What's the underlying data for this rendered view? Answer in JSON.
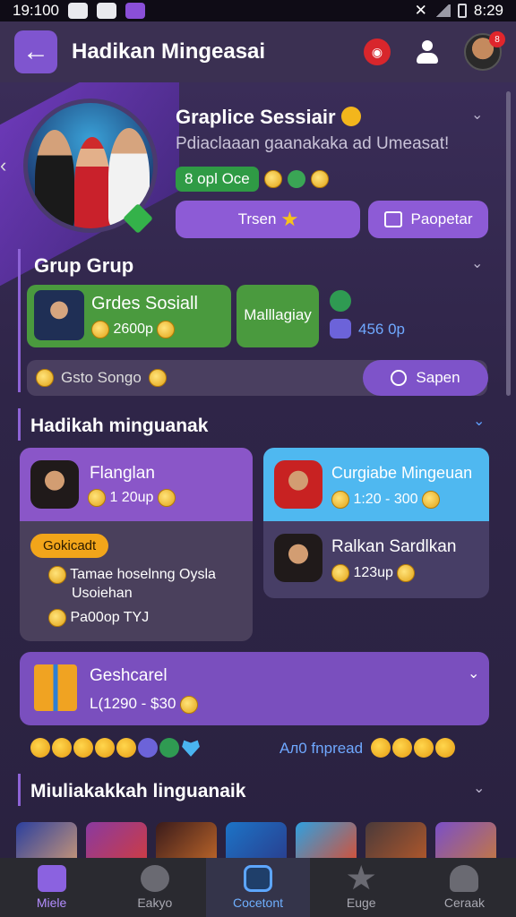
{
  "status_bar": {
    "time": "19:100",
    "time_right": "8:29"
  },
  "header": {
    "title": "Hadikan Mingeasai",
    "notification_badge": "8"
  },
  "profile": {
    "name": "Graplice Sessiair",
    "subtitle": "Pdiaclaaan gaanakaka ad Umeasat!",
    "level_label": "8 opl Oce",
    "buttons": {
      "primary": "Trsen",
      "secondary": "Paopetar"
    }
  },
  "group_section": {
    "title": "Grup Grup",
    "card_main": {
      "title": "Grdes Sosiall",
      "value": "2600p"
    },
    "card_secondary": {
      "title": "Malllagiay"
    },
    "counter": "456 0p"
  },
  "search": {
    "label": "Gsto Songo",
    "button": "Sapen"
  },
  "hadikah_section": {
    "title": "Hadikah minguanak",
    "card_left": {
      "title": "Flanglan",
      "value": "1 20up",
      "pill": "Gokicadt",
      "desc_line1": "Tamae hoselnng Oysla",
      "desc_line2": "Usoiehan",
      "footer": "Pa00op TYJ"
    },
    "card_right_top": {
      "title": "Curgiabe Mingeuan",
      "value_range": "1:20 - 300"
    },
    "card_right_bottom": {
      "title": "Ralkan Sardlkan",
      "value": "123up"
    }
  },
  "gift_card": {
    "title": "Geshcarel",
    "value": "L(1290 - $30"
  },
  "emoji_row": {
    "auto_label": "Aл0 fnpread"
  },
  "games_section": {
    "title": "Miuliakakkah linguanaik"
  },
  "bottom_nav": [
    {
      "label": "Miele"
    },
    {
      "label": "Eakyo"
    },
    {
      "label": "Cocetont"
    },
    {
      "label": "Euge"
    },
    {
      "label": "Ceraak"
    }
  ]
}
